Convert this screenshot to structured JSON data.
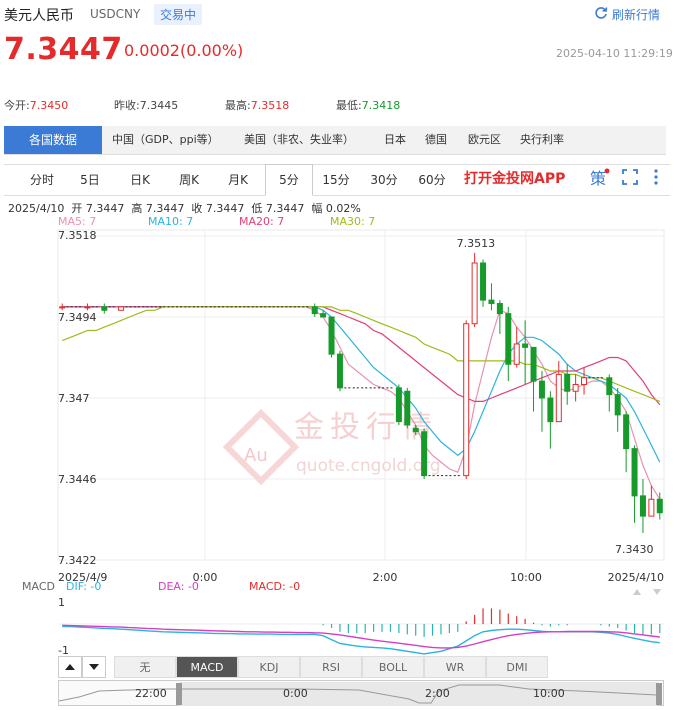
{
  "header": {
    "name": "美元人民币",
    "code": "USDCNY",
    "status": "交易中",
    "refresh_label": "刷新行情"
  },
  "quote": {
    "price": "7.3447",
    "change": "0.0002(0.00%)",
    "timestamp": "2025-04-10 11:29:19"
  },
  "stats": [
    {
      "label": "今开:",
      "value": "7.3450",
      "color": "red"
    },
    {
      "label": "昨收:",
      "value": "7.3445",
      "color": "none"
    },
    {
      "label": "最高:",
      "value": "7.3518",
      "color": "red"
    },
    {
      "label": "最低:",
      "value": "7.3418",
      "color": "green"
    }
  ],
  "tabs": {
    "active": "各国数据",
    "items": [
      "中国（GDP、ppi等）",
      "美国（非农、失业率）",
      "日本",
      "德国",
      "欧元区",
      "央行利率"
    ]
  },
  "periods": {
    "items": [
      "分时",
      "5日",
      "日K",
      "周K",
      "月K",
      "5分",
      "15分",
      "30分",
      "60分"
    ],
    "active": "5分",
    "app_link": "打开金投网APP"
  },
  "candle_info": {
    "date": "2025/4/10",
    "open": "开 7.3447",
    "high": "高 7.3447",
    "close": "收 7.3447",
    "low": "低 7.3447",
    "amp": "幅 0.02%"
  },
  "ma_legend": [
    {
      "label": "MA5: 7",
      "color": "#e792b3"
    },
    {
      "label": "MA10: 7",
      "color": "#2bb3dd"
    },
    {
      "label": "MA20: 7",
      "color": "#e0407a"
    },
    {
      "label": "MA30: 7",
      "color": "#9dbb1e"
    }
  ],
  "macd_legend": {
    "title": "MACD",
    "dif": "DIF: -0",
    "dea": "DEA: -0",
    "macd": "MACD: -0"
  },
  "watermark": {
    "text": "金投行情",
    "url": "quote.cngold.org",
    "badge": "Au"
  },
  "indicator_tabs": {
    "items": [
      "无",
      "MACD",
      "KDJ",
      "RSI",
      "BOLL",
      "WR",
      "DMI"
    ],
    "active": "MACD"
  },
  "navigator_labels": [
    "22:00",
    "0:00",
    "2:00",
    "10:00"
  ],
  "colors": {
    "up": "#e42b2b",
    "down": "#169b2a",
    "accent": "#3b7bd6"
  },
  "chart_data": {
    "type": "candlestick",
    "ylim": [
      7.3422,
      7.3518
    ],
    "y_tick_labels": [
      "7.3518",
      "7.3494",
      "7.347",
      "7.3446",
      "7.3422"
    ],
    "x_tick_labels": [
      "2025/4/9",
      "0:00",
      "2:00",
      "10:00",
      "2025/4/10"
    ],
    "annotations": {
      "high_label": "7.3513",
      "low_label": "7.3430"
    },
    "candles": [
      [
        7.3497,
        7.3497,
        7.3498,
        7.3496
      ],
      [
        7.3497,
        7.3497,
        7.3497,
        7.3497
      ],
      [
        7.3497,
        7.3497,
        7.3497,
        7.3497
      ],
      [
        7.3497,
        7.3497,
        7.3498,
        7.3496
      ],
      [
        7.3497,
        7.3497,
        7.3497,
        7.3497
      ],
      [
        7.3497,
        7.3496,
        7.3498,
        7.3495
      ],
      [
        7.3497,
        7.3497,
        7.3497,
        7.3497
      ],
      [
        7.3496,
        7.3497,
        7.3497,
        7.3496
      ],
      [
        7.3497,
        7.3497,
        7.3497,
        7.3497
      ],
      [
        7.3497,
        7.3497,
        7.3497,
        7.3497
      ],
      [
        7.3497,
        7.3497,
        7.3497,
        7.3497
      ],
      [
        7.3497,
        7.3497,
        7.3497,
        7.3497
      ],
      [
        7.3497,
        7.3497,
        7.3497,
        7.3497
      ],
      [
        7.3497,
        7.3497,
        7.3497,
        7.3497
      ],
      [
        7.3497,
        7.3497,
        7.3497,
        7.3497
      ],
      [
        7.3497,
        7.3497,
        7.3497,
        7.3497
      ],
      [
        7.3497,
        7.3497,
        7.3497,
        7.3497
      ],
      [
        7.3497,
        7.3497,
        7.3497,
        7.3497
      ],
      [
        7.3497,
        7.3497,
        7.3497,
        7.3497
      ],
      [
        7.3497,
        7.3497,
        7.3497,
        7.3497
      ],
      [
        7.3497,
        7.3497,
        7.3497,
        7.3497
      ],
      [
        7.3497,
        7.3497,
        7.3497,
        7.3497
      ],
      [
        7.3497,
        7.3497,
        7.3497,
        7.3497
      ],
      [
        7.3497,
        7.3497,
        7.3497,
        7.3497
      ],
      [
        7.3497,
        7.3497,
        7.3497,
        7.3497
      ],
      [
        7.3497,
        7.3497,
        7.3497,
        7.3497
      ],
      [
        7.3497,
        7.3497,
        7.3497,
        7.3497
      ],
      [
        7.3497,
        7.3497,
        7.3497,
        7.3497
      ],
      [
        7.3497,
        7.3497,
        7.3497,
        7.3497
      ],
      [
        7.3497,
        7.3497,
        7.3497,
        7.3497
      ],
      [
        7.3497,
        7.3495,
        7.3498,
        7.3494
      ],
      [
        7.3495,
        7.3494,
        7.3496,
        7.3494
      ],
      [
        7.3494,
        7.3483,
        7.3494,
        7.3482
      ],
      [
        7.3483,
        7.3473,
        7.3484,
        7.3472
      ],
      [
        7.3473,
        7.3473,
        7.3473,
        7.3473
      ],
      [
        7.3473,
        7.3473,
        7.3473,
        7.3473
      ],
      [
        7.3473,
        7.3473,
        7.3473,
        7.3473
      ],
      [
        7.3473,
        7.3473,
        7.3473,
        7.3473
      ],
      [
        7.3473,
        7.3473,
        7.3473,
        7.3473
      ],
      [
        7.3473,
        7.3473,
        7.3473,
        7.3473
      ],
      [
        7.3473,
        7.3463,
        7.3474,
        7.3462
      ],
      [
        7.3472,
        7.3462,
        7.3473,
        7.3461
      ],
      [
        7.3461,
        7.346,
        7.3462,
        7.3459
      ],
      [
        7.346,
        7.3447,
        7.3461,
        7.3446
      ],
      [
        7.3447,
        7.3447,
        7.3447,
        7.3447
      ],
      [
        7.3447,
        7.3447,
        7.3447,
        7.3447
      ],
      [
        7.3447,
        7.3447,
        7.3447,
        7.3447
      ],
      [
        7.3447,
        7.3447,
        7.3447,
        7.3447
      ],
      [
        7.3447,
        7.3492,
        7.3493,
        7.3446
      ],
      [
        7.3492,
        7.351,
        7.3513,
        7.3491
      ],
      [
        7.351,
        7.3499,
        7.3511,
        7.3497
      ],
      [
        7.3499,
        7.3498,
        7.3504,
        7.3496
      ],
      [
        7.3498,
        7.3495,
        7.3499,
        7.3489
      ],
      [
        7.3495,
        7.348,
        7.3497,
        7.3475
      ],
      [
        7.348,
        7.3486,
        7.3491,
        7.3479
      ],
      [
        7.3486,
        7.3485,
        7.3493,
        7.3474
      ],
      [
        7.3485,
        7.3475,
        7.3485,
        7.3466
      ],
      [
        7.3475,
        7.347,
        7.3478,
        7.346
      ],
      [
        7.347,
        7.3463,
        7.3472,
        7.3455
      ],
      [
        7.3463,
        7.3477,
        7.3481,
        7.3463
      ],
      [
        7.3477,
        7.3472,
        7.348,
        7.3468
      ],
      [
        7.3472,
        7.3474,
        7.3477,
        7.3469
      ],
      [
        7.3474,
        7.3476,
        7.3479,
        7.3471
      ],
      [
        7.3476,
        7.3476,
        7.3476,
        7.3476
      ],
      [
        7.3476,
        7.3476,
        7.3476,
        7.3476
      ],
      [
        7.3476,
        7.3471,
        7.3477,
        7.3466
      ],
      [
        7.3471,
        7.3465,
        7.3473,
        7.346
      ],
      [
        7.3465,
        7.3455,
        7.3466,
        7.3448
      ],
      [
        7.3455,
        7.3441,
        7.3456,
        7.3433
      ],
      [
        7.3441,
        7.3435,
        7.3446,
        7.343
      ],
      [
        7.3435,
        7.344,
        7.3444,
        7.3435
      ],
      [
        7.344,
        7.3436,
        7.3442,
        7.3434
      ]
    ],
    "ma": {
      "MA5": [
        7.3497,
        7.3497,
        7.3497,
        7.3497,
        7.3497,
        7.3497,
        7.3497,
        7.3497,
        7.3497,
        7.3497,
        7.3497,
        7.3497,
        7.3497,
        7.3497,
        7.3497,
        7.3497,
        7.3497,
        7.3497,
        7.3497,
        7.3497,
        7.3497,
        7.3497,
        7.3497,
        7.3497,
        7.3497,
        7.3497,
        7.3497,
        7.3497,
        7.3497,
        7.3497,
        7.3496,
        7.3494,
        7.349,
        7.3485,
        7.348,
        7.3478,
        7.3476,
        7.3474,
        7.3473,
        7.3472,
        7.347,
        7.3466,
        7.3462,
        7.3456,
        7.3453,
        7.3451,
        7.3449,
        7.3448,
        7.3455,
        7.3468,
        7.3478,
        7.3488,
        7.3496,
        7.3495,
        7.3491,
        7.3488,
        7.3484,
        7.348,
        7.3475,
        7.3473,
        7.3472,
        7.3473,
        7.3474,
        7.3475,
        7.3475,
        7.3473,
        7.347,
        7.3466,
        7.3458,
        7.345,
        7.3444,
        7.344
      ],
      "MA10": [
        7.3497,
        7.3497,
        7.3497,
        7.3497,
        7.3497,
        7.3497,
        7.3497,
        7.3497,
        7.3497,
        7.3497,
        7.3497,
        7.3497,
        7.3497,
        7.3497,
        7.3497,
        7.3497,
        7.3497,
        7.3497,
        7.3497,
        7.3497,
        7.3497,
        7.3497,
        7.3497,
        7.3497,
        7.3497,
        7.3497,
        7.3497,
        7.3497,
        7.3497,
        7.3497,
        7.3497,
        7.3496,
        7.3494,
        7.3491,
        7.3488,
        7.3485,
        7.3482,
        7.3479,
        7.3477,
        7.3475,
        7.3473,
        7.347,
        7.3467,
        7.3463,
        7.346,
        7.3457,
        7.3455,
        7.3453,
        7.3455,
        7.346,
        7.3466,
        7.3472,
        7.3478,
        7.3483,
        7.3486,
        7.3488,
        7.3488,
        7.3487,
        7.3485,
        7.3483,
        7.348,
        7.3478,
        7.3477,
        7.3476,
        7.3475,
        7.3474,
        7.3472,
        7.347,
        7.3466,
        7.3461,
        7.3456,
        7.3451
      ],
      "MA20": [
        7.3497,
        7.3497,
        7.3497,
        7.3497,
        7.3497,
        7.3497,
        7.3497,
        7.3497,
        7.3497,
        7.3497,
        7.3497,
        7.3497,
        7.3497,
        7.3497,
        7.3497,
        7.3497,
        7.3497,
        7.3497,
        7.3497,
        7.3497,
        7.3497,
        7.3497,
        7.3497,
        7.3497,
        7.3497,
        7.3497,
        7.3497,
        7.3497,
        7.3497,
        7.3497,
        7.3497,
        7.3497,
        7.3496,
        7.3495,
        7.3494,
        7.3493,
        7.3492,
        7.349,
        7.3489,
        7.3487,
        7.3485,
        7.3483,
        7.3481,
        7.3479,
        7.3477,
        7.3475,
        7.3473,
        7.3471,
        7.347,
        7.3469,
        7.3469,
        7.347,
        7.3471,
        7.3472,
        7.3473,
        7.3474,
        7.3475,
        7.3476,
        7.3477,
        7.3478,
        7.3478,
        7.3478,
        7.3479,
        7.348,
        7.3481,
        7.3482,
        7.3482,
        7.3481,
        7.3478,
        7.3475,
        7.3471,
        7.3468
      ],
      "MA30": [
        7.3487,
        7.3488,
        7.3489,
        7.349,
        7.349,
        7.3491,
        7.3492,
        7.3493,
        7.3494,
        7.3495,
        7.3496,
        7.3496,
        7.3497,
        7.3497,
        7.3497,
        7.3497,
        7.3497,
        7.3497,
        7.3497,
        7.3497,
        7.3497,
        7.3497,
        7.3497,
        7.3497,
        7.3497,
        7.3497,
        7.3497,
        7.3497,
        7.3497,
        7.3497,
        7.3497,
        7.3497,
        7.3497,
        7.3496,
        7.3496,
        7.3495,
        7.3494,
        7.3493,
        7.3492,
        7.3491,
        7.349,
        7.3489,
        7.3488,
        7.3486,
        7.3485,
        7.3484,
        7.3483,
        7.3481,
        7.3481,
        7.3481,
        7.3481,
        7.3481,
        7.3481,
        7.3481,
        7.3481,
        7.348,
        7.348,
        7.3479,
        7.3478,
        7.3478,
        7.3477,
        7.3477,
        7.3476,
        7.3476,
        7.3476,
        7.3475,
        7.3474,
        7.3473,
        7.3472,
        7.3471,
        7.347,
        7.3469
      ]
    },
    "macd": {
      "ylim": [
        -1,
        1
      ],
      "y_tick_labels": [
        "1",
        "-1"
      ],
      "hist": [
        0,
        0,
        0,
        0,
        0,
        0,
        0,
        0,
        0,
        0,
        0,
        0,
        0,
        0,
        0,
        0,
        0,
        0,
        0,
        0,
        0,
        0,
        0,
        0,
        0,
        0,
        0,
        0,
        0,
        0,
        0,
        -0.05,
        -0.15,
        -0.3,
        -0.35,
        -0.35,
        -0.35,
        -0.3,
        -0.3,
        -0.3,
        -0.35,
        -0.4,
        -0.45,
        -0.5,
        -0.45,
        -0.4,
        -0.35,
        -0.3,
        0.1,
        0.35,
        0.6,
        0.6,
        0.55,
        0.4,
        0.3,
        0.2,
        0.05,
        -0.05,
        -0.1,
        -0.05,
        -0.05,
        0,
        0,
        0,
        -0.05,
        -0.1,
        -0.15,
        -0.25,
        -0.35,
        -0.4,
        -0.4,
        -0.35
      ],
      "dif": [
        -0.1,
        -0.1,
        -0.12,
        -0.13,
        -0.15,
        -0.17,
        -0.18,
        -0.2,
        -0.22,
        -0.24,
        -0.26,
        -0.28,
        -0.3,
        -0.31,
        -0.32,
        -0.33,
        -0.34,
        -0.35,
        -0.36,
        -0.37,
        -0.37,
        -0.38,
        -0.38,
        -0.39,
        -0.39,
        -0.39,
        -0.4,
        -0.4,
        -0.4,
        -0.4,
        -0.4,
        -0.45,
        -0.6,
        -0.75,
        -0.8,
        -0.85,
        -0.88,
        -0.9,
        -0.92,
        -0.95,
        -1.0,
        -1.05,
        -1.1,
        -1.15,
        -1.1,
        -1.05,
        -0.95,
        -0.85,
        -0.65,
        -0.45,
        -0.3,
        -0.25,
        -0.22,
        -0.2,
        -0.2,
        -0.22,
        -0.25,
        -0.28,
        -0.3,
        -0.3,
        -0.3,
        -0.3,
        -0.3,
        -0.3,
        -0.32,
        -0.35,
        -0.4,
        -0.48,
        -0.55,
        -0.62,
        -0.68,
        -0.72
      ],
      "dea": [
        -0.05,
        -0.06,
        -0.07,
        -0.08,
        -0.09,
        -0.1,
        -0.11,
        -0.12,
        -0.14,
        -0.15,
        -0.17,
        -0.18,
        -0.2,
        -0.21,
        -0.22,
        -0.23,
        -0.24,
        -0.25,
        -0.26,
        -0.27,
        -0.28,
        -0.29,
        -0.3,
        -0.3,
        -0.31,
        -0.31,
        -0.32,
        -0.32,
        -0.33,
        -0.33,
        -0.34,
        -0.35,
        -0.38,
        -0.42,
        -0.47,
        -0.52,
        -0.57,
        -0.62,
        -0.66,
        -0.7,
        -0.74,
        -0.78,
        -0.82,
        -0.87,
        -0.9,
        -0.92,
        -0.92,
        -0.9,
        -0.85,
        -0.77,
        -0.68,
        -0.6,
        -0.52,
        -0.45,
        -0.4,
        -0.36,
        -0.33,
        -0.31,
        -0.3,
        -0.3,
        -0.29,
        -0.29,
        -0.29,
        -0.29,
        -0.29,
        -0.3,
        -0.31,
        -0.34,
        -0.38,
        -0.42,
        -0.46,
        -0.5
      ]
    }
  }
}
